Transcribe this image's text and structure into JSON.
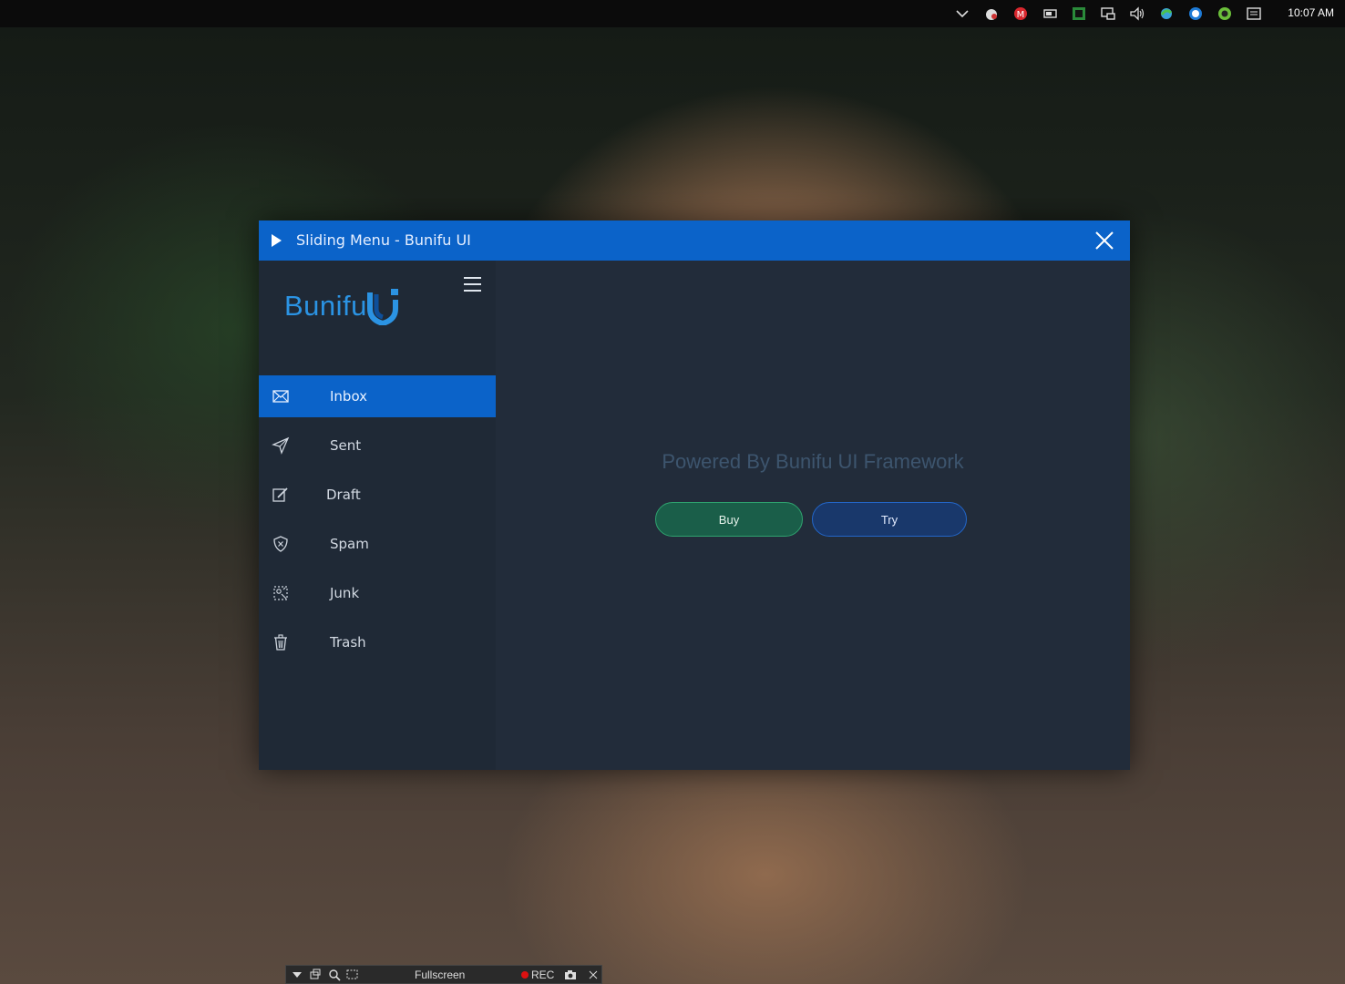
{
  "taskbar": {
    "clock": "10:07 AM",
    "tray_icons": [
      "chevron-up-icon",
      "app-icon",
      "mega-icon",
      "battery-icon",
      "green-app-icon",
      "network-icon",
      "volume-icon",
      "sync-icon",
      "info-icon",
      "green-circle-icon",
      "notification-icon"
    ]
  },
  "window": {
    "title": "Sliding Menu - Bunifu UI"
  },
  "logo": {
    "text": "Bunifu"
  },
  "menu": {
    "items": [
      {
        "label": "Inbox",
        "icon": "mail-icon",
        "active": true
      },
      {
        "label": "Sent",
        "icon": "send-icon"
      },
      {
        "label": "Draft",
        "icon": "edit-icon"
      },
      {
        "label": "Spam",
        "icon": "shield-icon"
      },
      {
        "label": "Junk",
        "icon": "junk-icon"
      },
      {
        "label": "Trash",
        "icon": "trash-icon"
      }
    ]
  },
  "main": {
    "powered_text": "Powered By Bunifu UI Framework",
    "buy_label": "Buy",
    "try_label": "Try"
  },
  "recorder": {
    "fullscreen_label": "Fullscreen",
    "rec_label": "REC"
  },
  "colors": {
    "accent": "#0b63c9",
    "sidebar_bg": "#1f2936",
    "main_bg": "#222c3a",
    "buy_bg": "#1a5e49",
    "try_bg": "#19386b",
    "logo": "#2b93e3"
  }
}
